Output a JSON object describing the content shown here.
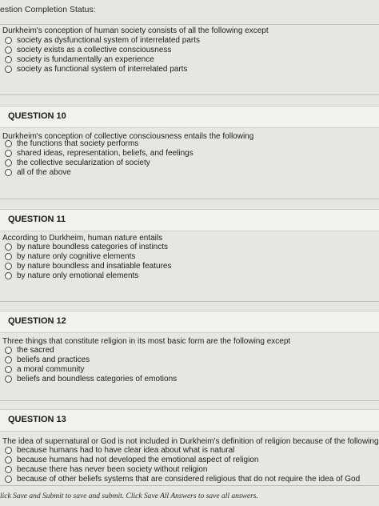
{
  "status_label": "estion Completion Status:",
  "questions": [
    {
      "number": "",
      "stem": "Durkheim's conception of human society consists of all the following except",
      "options": [
        "society as dysfunctional system of interrelated parts",
        "society exists as a collective consciousness",
        "society is fundamentally an experience",
        "society as functional system of interrelated parts"
      ]
    },
    {
      "number": "QUESTION 10",
      "stem": "Durkheim's conception of collective consciousness entails the following",
      "options": [
        "the functions that society performs",
        "shared ideas, representation, beliefs, and feelings",
        "the collective secularization of society",
        "all of the above"
      ]
    },
    {
      "number": "QUESTION 11",
      "stem": "According to Durkheim, human nature entails",
      "options": [
        "by nature boundless categories of instincts",
        "by nature only cognitive elements",
        "by nature boundless and insatiable features",
        "by nature only emotional elements"
      ]
    },
    {
      "number": "QUESTION 12",
      "stem": "Three things that constitute religion in its most basic form are the following except",
      "options": [
        "the sacred",
        "beliefs and practices",
        "a moral community",
        "beliefs and boundless categories of emotions"
      ]
    },
    {
      "number": "QUESTION 13",
      "stem": "The idea of supernatural or God is not included in Durkheim's definition of religion because of the following exce",
      "options": [
        "because humans had to have clear idea about what is natural",
        "because humans had not developed the emotional aspect of religion",
        "because there has never been society without religion",
        "because of other beliefs systems that are considered religious that do not require the idea of God"
      ]
    }
  ],
  "footer_text": "lick Save and Submit to save and submit. Click Save All Answers to save all answers."
}
